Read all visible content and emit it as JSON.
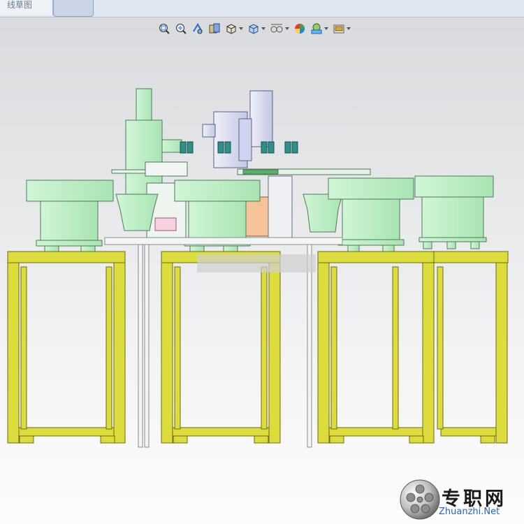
{
  "tabs": {
    "sketch_label": "线草图",
    "active_label": ""
  },
  "toolbar": {
    "items": [
      {
        "icon": "zoom-to-fit-icon",
        "dropdown": false
      },
      {
        "icon": "zoom-area-icon",
        "dropdown": false
      },
      {
        "icon": "previous-view-icon",
        "dropdown": false
      },
      {
        "icon": "section-view-icon",
        "dropdown": false
      },
      {
        "icon": "view-orientation-icon",
        "dropdown": true
      },
      {
        "icon": "display-style-icon",
        "dropdown": true
      },
      {
        "icon": "hide-show-items-icon",
        "dropdown": true
      },
      {
        "icon": "edit-appearance-icon",
        "dropdown": false
      },
      {
        "icon": "apply-scene-icon",
        "dropdown": true
      },
      {
        "icon": "view-settings-icon",
        "dropdown": true
      }
    ]
  },
  "model": {
    "frame_color": "#dcdc3c",
    "frame_edge": "#6b6b14",
    "part_color": "#bdf0c7",
    "part_edge": "#4f7a57",
    "metal_color": "#d6d9f0",
    "accent_orange": "#f4c39a"
  },
  "watermark": {
    "chinese": "专职网",
    "english": "Zhuanzhi.Net"
  }
}
